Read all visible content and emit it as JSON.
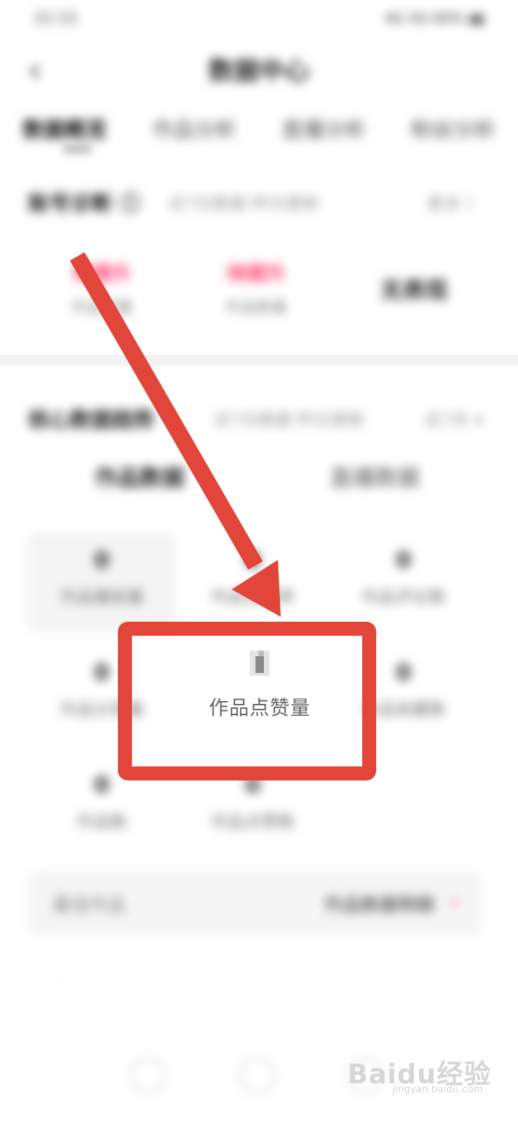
{
  "status_bar": {
    "time": "11:11",
    "right": "4G 5G 60% ▮▮"
  },
  "header": {
    "back_icon": "chevron-left-icon",
    "title": "数据中心"
  },
  "tabs": [
    "数据概览",
    "作品分析",
    "直播分析",
    "粉丝分析"
  ],
  "overview": {
    "title": "账号诊断 ⓘ",
    "subtitle": "近7日数据 昨日更新",
    "more": "更多 〉",
    "metrics": [
      {
        "value": "待提升",
        "label": "作品质量"
      },
      {
        "value": "待提升",
        "label": "作品数量"
      },
      {
        "value": "无表现"
      }
    ]
  },
  "core": {
    "title": "核心数据趋势",
    "subtitle": "近7日数据 昨日更新",
    "more": "近7天 ▾",
    "subtabs": [
      "作品数据",
      "直播数据"
    ],
    "cells": [
      {
        "value": "0",
        "label": "作品播放量"
      },
      {
        "value": "0",
        "label": "作品完播率"
      },
      {
        "value": "0",
        "label": "作品评论数"
      },
      {
        "value": "0",
        "label": "作品分享量"
      },
      {
        "value": "0",
        "label": "作品点赞量"
      },
      {
        "value": "0",
        "label": "作品收藏数"
      },
      {
        "value": "0",
        "label": "作品数"
      },
      {
        "value": "0",
        "label": "作品点赞数"
      }
    ]
  },
  "bottom_card": {
    "left": "最佳作品",
    "right": "作品数据明细",
    "arrow": "›"
  },
  "watermark": {
    "text": "Baidu经验",
    "sub": "jingyan.baidu.com"
  },
  "highlight": {
    "color": "#e2463a"
  },
  "accent": "#ff3a6e"
}
